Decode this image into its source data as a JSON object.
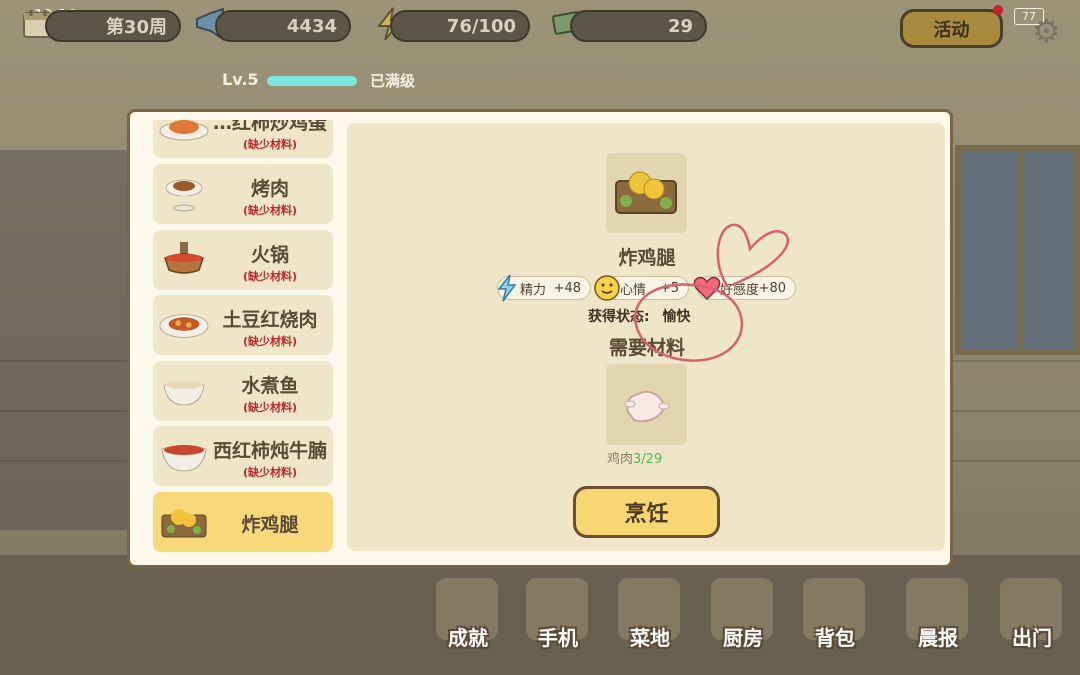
{
  "status_bar": {
    "time": "12:10",
    "battery": "77"
  },
  "hud": {
    "week": "第30周",
    "coins": "4434",
    "energy": "76/100",
    "money": "29",
    "activity_label": "活动"
  },
  "level": {
    "label": "Lv.5",
    "progress": 1.0,
    "status": "已满级"
  },
  "dish_list": [
    {
      "name": "…红柿炒鸡蛋",
      "missing": "(缺少材料)",
      "selected": false
    },
    {
      "name": "烤肉",
      "missing": "(缺少材料)",
      "selected": false
    },
    {
      "name": "火锅",
      "missing": "(缺少材料)",
      "selected": false
    },
    {
      "name": "土豆红烧肉",
      "missing": "(缺少材料)",
      "selected": false
    },
    {
      "name": "水煮鱼",
      "missing": "(缺少材料)",
      "selected": false
    },
    {
      "name": "西红柿炖牛腩",
      "missing": "(缺少材料)",
      "selected": false
    },
    {
      "name": "炸鸡腿",
      "missing": "",
      "selected": true
    }
  ],
  "detail": {
    "title": "炸鸡腿",
    "stats": [
      {
        "label": "精力",
        "value": "+48",
        "icon": "lightning-icon"
      },
      {
        "label": "心情",
        "value": "+5",
        "icon": "smiley-icon"
      },
      {
        "label": "好感度",
        "value": "+80",
        "icon": "heart-icon"
      }
    ],
    "state_label": "获得状态:",
    "state_value": "愉快",
    "materials_title": "需要材料",
    "material": {
      "name": "鸡肉",
      "have": "3",
      "need": "/29",
      "icon": "raw-chicken-icon"
    },
    "cook_label": "烹饪"
  },
  "bottom_nav": [
    {
      "label": "成就",
      "icon": "medal-icon"
    },
    {
      "label": "手机",
      "icon": "phone-icon"
    },
    {
      "label": "菜地",
      "icon": "garden-icon"
    },
    {
      "label": "厨房",
      "icon": "pot-icon"
    },
    {
      "label": "背包",
      "icon": "backpack-icon"
    },
    {
      "label": "晨报",
      "icon": "newspaper-icon"
    },
    {
      "label": "出门",
      "icon": "map-icon"
    }
  ],
  "colors": {
    "accent": "#f8d772",
    "missing": "#c0282b",
    "have": "#54b84f",
    "level_bar": "#7de6dd"
  }
}
